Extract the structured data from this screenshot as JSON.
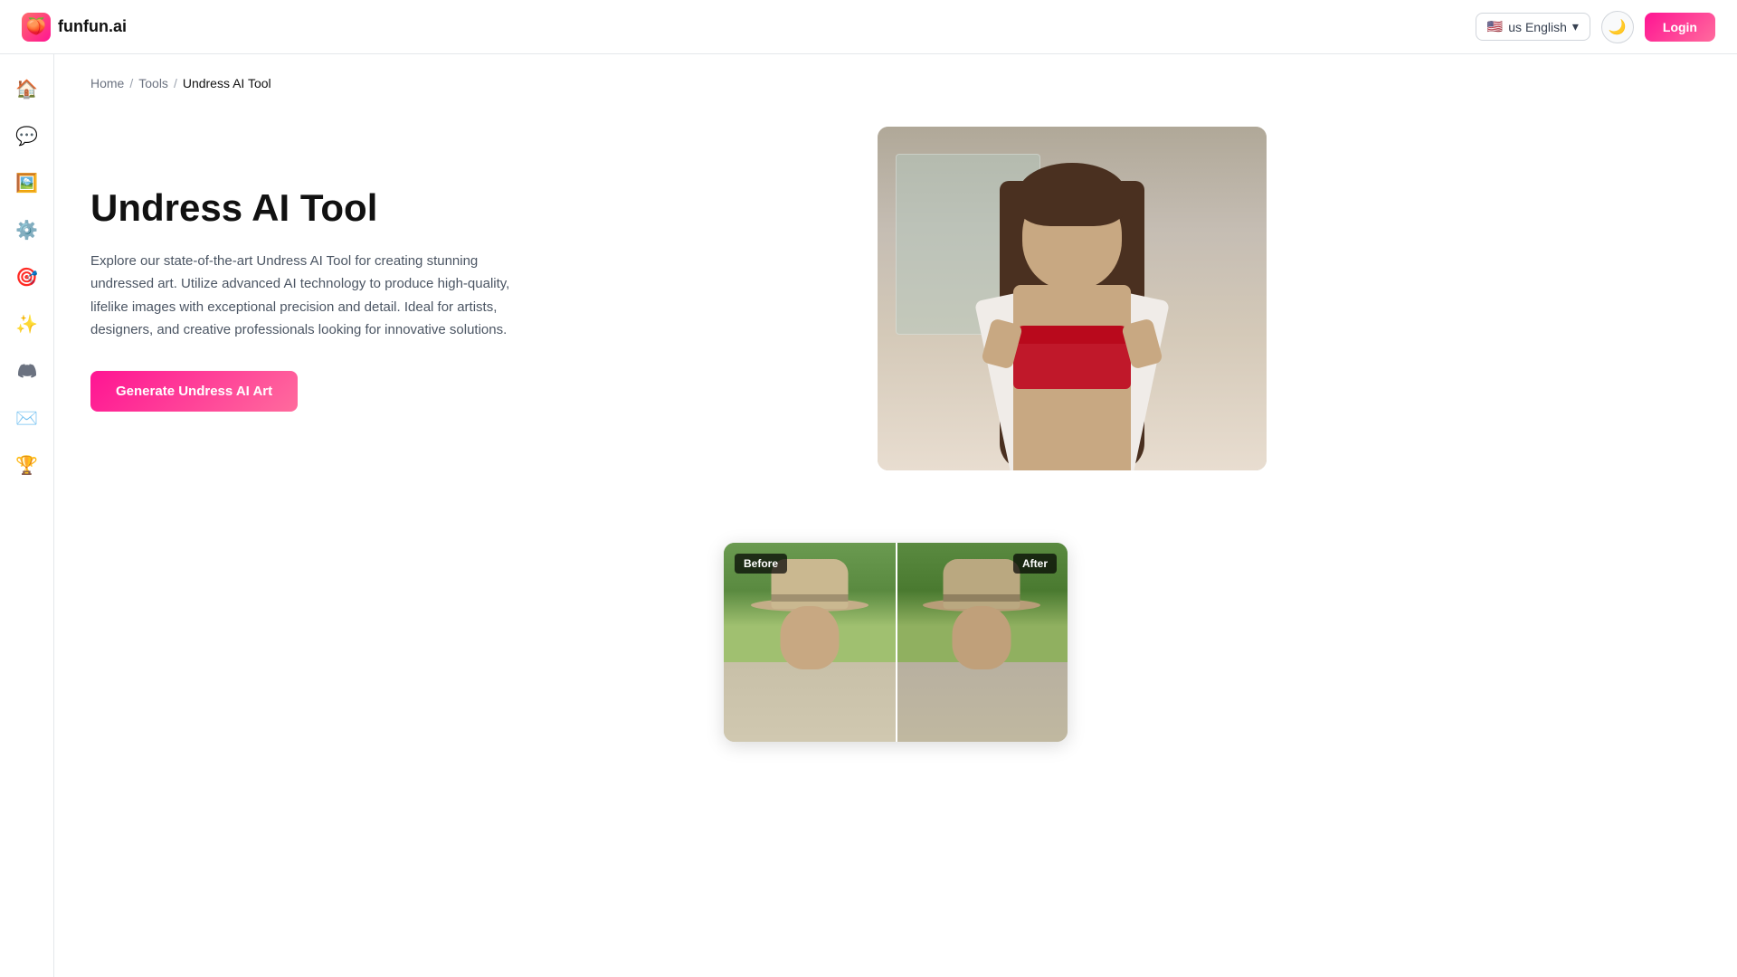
{
  "navbar": {
    "logo_text": "funfun.ai",
    "lang_flag": "🇺🇸",
    "lang_label": "us English",
    "login_label": "Login"
  },
  "breadcrumb": {
    "home": "Home",
    "sep1": "/",
    "tools": "Tools",
    "sep2": "/",
    "current": "Undress AI Tool"
  },
  "hero": {
    "title": "Undress AI Tool",
    "description": "Explore our state-of-the-art Undress AI Tool for creating stunning undressed art. Utilize advanced AI technology to produce high-quality, lifelike images with exceptional precision and detail. Ideal for artists, designers, and creative professionals looking for innovative solutions.",
    "cta_label": "Generate Undress AI Art"
  },
  "comparison": {
    "before_label": "Before",
    "after_label": "After"
  },
  "sidebar": {
    "items": [
      {
        "name": "home",
        "icon": "🏠"
      },
      {
        "name": "chat",
        "icon": "💬"
      },
      {
        "name": "image",
        "icon": "🖼️"
      },
      {
        "name": "settings",
        "icon": "⚙️"
      },
      {
        "name": "activity",
        "icon": "🎯"
      },
      {
        "name": "magic",
        "icon": "✨"
      },
      {
        "name": "discord",
        "icon": "🎮"
      },
      {
        "name": "email",
        "icon": "✉️"
      },
      {
        "name": "trophy",
        "icon": "🏆"
      }
    ]
  }
}
